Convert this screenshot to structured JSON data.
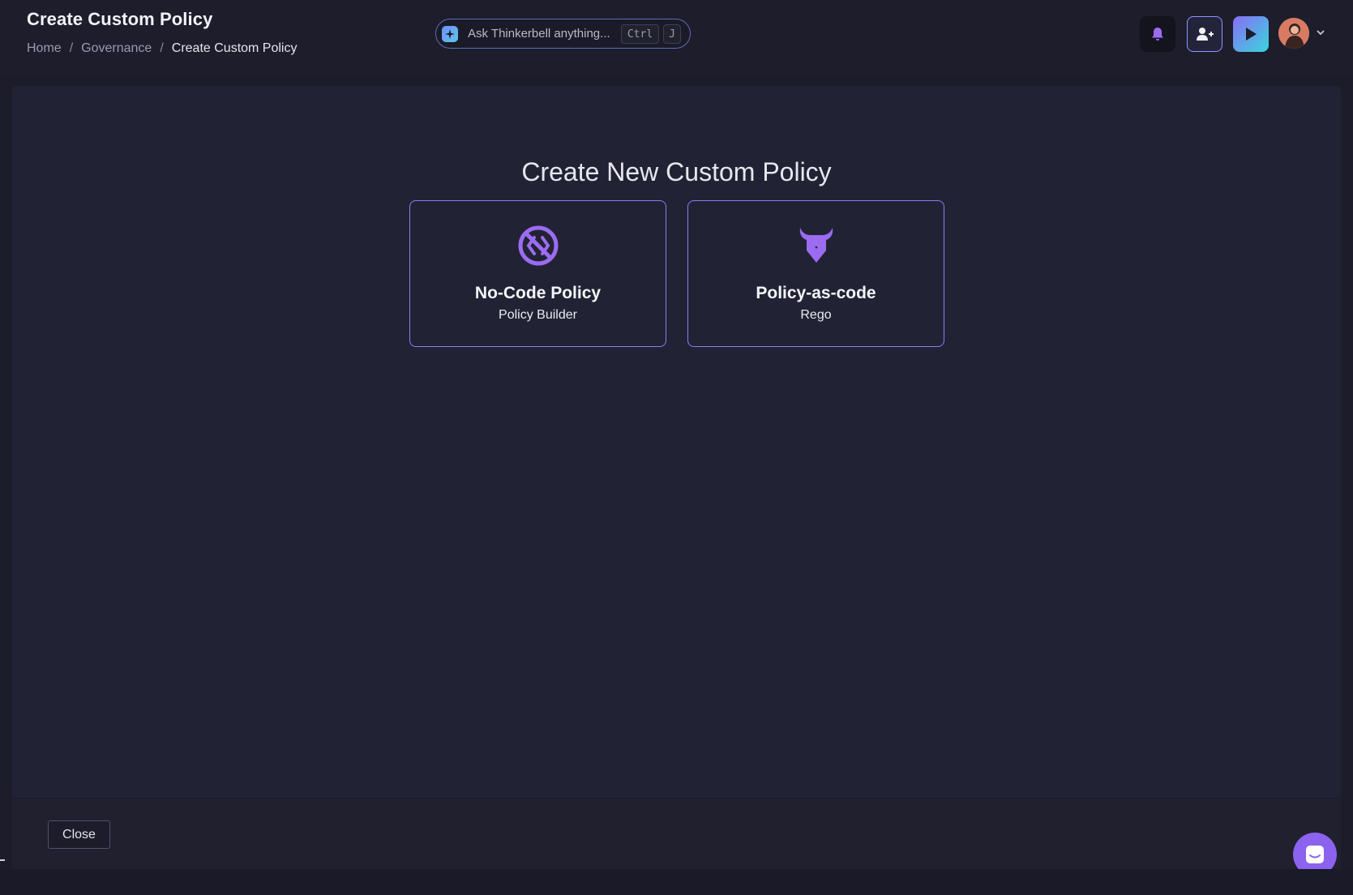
{
  "header": {
    "title": "Create Custom Policy",
    "breadcrumb": [
      "Home",
      "Governance",
      "Create Custom Policy"
    ],
    "breadcrumb_separator": "/"
  },
  "ask_bar": {
    "placeholder": "Ask Thinkerbell anything...",
    "shortcut_keys": [
      "Ctrl",
      "J"
    ]
  },
  "header_actions": {
    "icons": [
      "bell-icon",
      "add-user-icon",
      "play-icon",
      "chevron-down-icon"
    ]
  },
  "main": {
    "heading": "Create New Custom Policy",
    "options": [
      {
        "title": "No-Code Policy",
        "subtitle": "Policy Builder",
        "icon": "no-code-icon"
      },
      {
        "title": "Policy-as-code",
        "subtitle": "Rego",
        "icon": "rego-icon"
      }
    ]
  },
  "footer": {
    "close_label": "Close"
  },
  "colors": {
    "background": "#1c1c2b",
    "panel": "#222235",
    "accent": "#8b7cf2",
    "icon_purple": "#9b6cf0",
    "chat_button": "#8b63ee"
  }
}
